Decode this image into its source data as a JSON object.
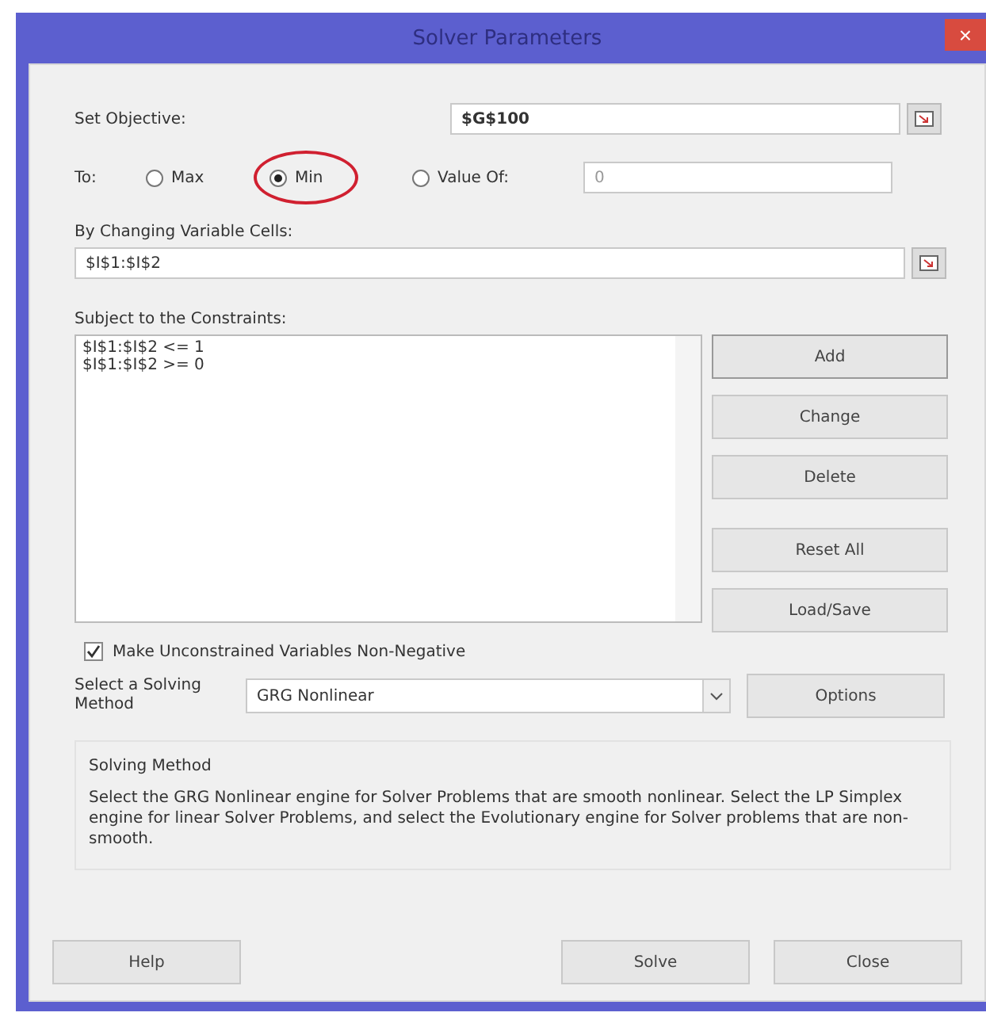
{
  "window": {
    "title": "Solver Parameters",
    "close": "×"
  },
  "objective": {
    "label": "Set Objective:",
    "value": "$G$100"
  },
  "to": {
    "label": "To:",
    "options": [
      {
        "label": "Max",
        "selected": false
      },
      {
        "label": "Min",
        "selected": true
      },
      {
        "label": "Value Of:",
        "selected": false
      }
    ],
    "value_of": "0"
  },
  "changing": {
    "label": "By Changing Variable Cells:",
    "value": "$I$1:$I$2"
  },
  "constraints": {
    "label": "Subject to the Constraints:",
    "items": [
      "$I$1:$I$2 <= 1",
      "$I$1:$I$2 >= 0"
    ]
  },
  "constraint_buttons": [
    "Add",
    "Change",
    "Delete",
    "Reset All",
    "Load/Save"
  ],
  "nonnegative": {
    "label": "Make Unconstrained Variables Non-Negative",
    "checked": true
  },
  "method": {
    "label": "Select a Solving Method",
    "value": "GRG Nonlinear",
    "options_button": "Options"
  },
  "group": {
    "title": "Solving Method",
    "text": "Select the GRG Nonlinear engine for Solver Problems that are smooth nonlinear. Select the LP Simplex engine for linear Solver Problems, and select the Evolutionary engine for Solver problems that are non-smooth."
  },
  "footer": [
    "Help",
    "Solve",
    "Close"
  ]
}
